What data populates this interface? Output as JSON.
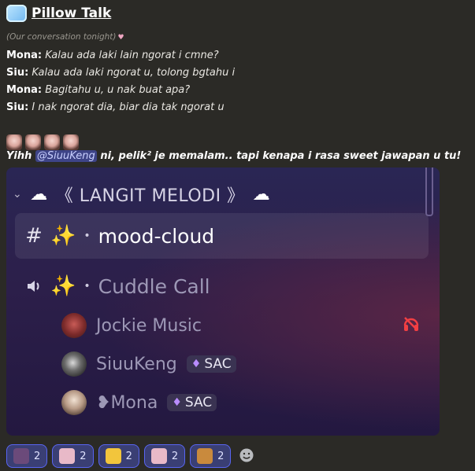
{
  "header": {
    "title": "Pillow Talk",
    "icon": "pillow-icon"
  },
  "note": {
    "text": "(Our conversation tonight)",
    "heart": "♥"
  },
  "dialogue": [
    {
      "speaker": "Mona:",
      "text": "Kalau ada laki lain ngorat i cmne?"
    },
    {
      "speaker": "Siu:",
      "text": "Kalau ada laki ngorat u, tolong bgtahu i"
    },
    {
      "speaker": "Mona:",
      "text": "Bagitahu u, u nak buat apa?"
    },
    {
      "speaker": "Siu:",
      "text": "I nak ngorat dia, biar dia tak ngorat u"
    }
  ],
  "emoji_row": {
    "count": 4,
    "icon": "face-emoji"
  },
  "comment": {
    "prefix": "Yihh ",
    "mention": "@SiuuKeng",
    "suffix": " ni, pelik² je memalam.. tapi kenapa i rasa sweet jawapan u tu!"
  },
  "embed": {
    "category": {
      "chevron": "⌄",
      "cloud": "☁",
      "label": "《 LANGIT MELODI 》"
    },
    "channels": [
      {
        "type": "text",
        "icon": "#",
        "emoji": "✨",
        "separator": "•",
        "name": "mood-cloud",
        "active": true
      },
      {
        "type": "voice",
        "emoji": "✨",
        "separator": "•",
        "name": "Cuddle Call",
        "active": false
      }
    ],
    "members": [
      {
        "name": "Jockie Music",
        "avatar": "jockie-avatar",
        "tag": null
      },
      {
        "name": "SiuuKeng",
        "avatar": "siuukeng-avatar",
        "tag": "SAC"
      },
      {
        "name": "Mona",
        "prefix": "❥",
        "avatar": "mona-avatar",
        "tag": "SAC"
      }
    ]
  },
  "reactions": [
    {
      "emoji": "anime-character",
      "count": "2",
      "color": "#6b4a7a"
    },
    {
      "emoji": "anime-girl-pink",
      "count": "2",
      "color": "#e8b9c8"
    },
    {
      "emoji": "pikachu",
      "count": "2",
      "color": "#f2c53c"
    },
    {
      "emoji": "anime-girl-pink",
      "count": "2",
      "color": "#e8b9c8"
    },
    {
      "emoji": "bear",
      "count": "2",
      "color": "#c98a3d"
    }
  ],
  "colors": {
    "accent": "#5865f2",
    "mention_bg": "#3e4487",
    "background": "#2b2a26"
  }
}
